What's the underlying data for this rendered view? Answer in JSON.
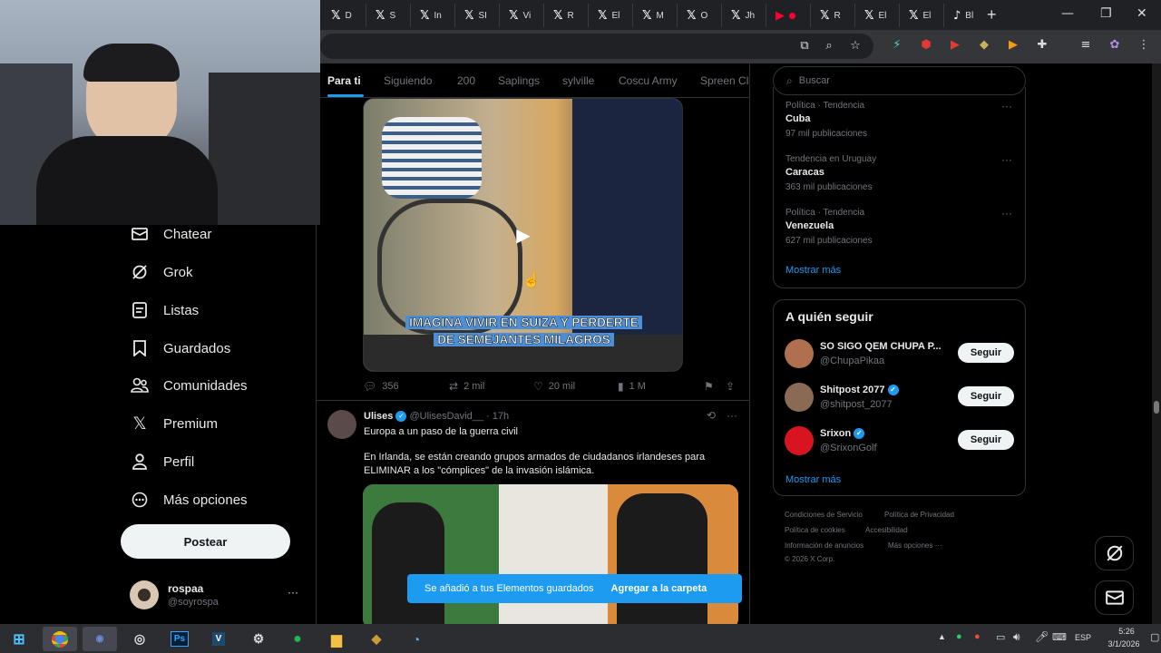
{
  "browser": {
    "tabs": [
      {
        "icon": "x-icon",
        "label": "D"
      },
      {
        "icon": "x-icon",
        "label": "S"
      },
      {
        "icon": "x-icon",
        "label": "In"
      },
      {
        "icon": "x-icon",
        "label": "SI"
      },
      {
        "icon": "x-icon",
        "label": "Vi"
      },
      {
        "icon": "x-icon",
        "label": "R"
      },
      {
        "icon": "x-icon",
        "label": "El"
      },
      {
        "icon": "x-icon",
        "label": "M"
      },
      {
        "icon": "x-icon",
        "label": "O"
      },
      {
        "icon": "x-icon",
        "label": "Jh"
      },
      {
        "icon": "youtube-icon",
        "label": ""
      },
      {
        "icon": "x-icon",
        "label": "R"
      },
      {
        "icon": "x-icon",
        "label": "El"
      },
      {
        "icon": "x-icon",
        "label": "El"
      },
      {
        "icon": "tiktok-icon",
        "label": "Bl"
      }
    ],
    "new_tab": "+"
  },
  "nav": {
    "items": [
      {
        "id": "chat",
        "label": "Chatear",
        "icon": "mail-icon"
      },
      {
        "id": "grok",
        "label": "Grok",
        "icon": "grok-icon"
      },
      {
        "id": "lists",
        "label": "Listas",
        "icon": "list-icon"
      },
      {
        "id": "bookmarks",
        "label": "Guardados",
        "icon": "bookmark-icon"
      },
      {
        "id": "communities",
        "label": "Comunidades",
        "icon": "people-icon"
      },
      {
        "id": "premium",
        "label": "Premium",
        "icon": "x-logo-icon"
      },
      {
        "id": "profile",
        "label": "Perfil",
        "icon": "user-icon"
      },
      {
        "id": "more",
        "label": "Más opciones",
        "icon": "more-circle-icon"
      }
    ],
    "post_label": "Postear",
    "account": {
      "name": "rospaa",
      "handle": "@soyrospa",
      "more": "···"
    }
  },
  "feed": {
    "tabs": [
      "Para ti",
      "Siguiendo",
      "200",
      "Saplings",
      "sylville",
      "Coscu Army",
      "Spreen Cl"
    ],
    "video_caption": [
      "IMAGINA VIVIR EN SUIZA Y PERDERTE",
      "DE SEMEJANTES MILAGROS"
    ],
    "tweet1_stats": {
      "replies": "356",
      "reposts": "2 mil",
      "likes": "20 mil",
      "views": "1 M"
    },
    "tweet2": {
      "name": "Ulises",
      "handle": "@UlisesDavid__",
      "time": "· 17h",
      "line1": "Europa a un paso de la guerra civil",
      "line2": "En Irlanda, se están creando grupos armados de ciudadanos irlandeses para ELIMINAR a los \"cómplices\" de la invasión islámica."
    },
    "toast": {
      "message": "Se añadió a tus Elementos guardados",
      "action": "Agregar a la carpeta"
    }
  },
  "sidebar": {
    "search_placeholder": "Buscar",
    "trends": [
      {
        "context": "Política · Tendencia",
        "name": "Cuba",
        "count": "97 mil publicaciones"
      },
      {
        "context": "Tendencia en Uruguay",
        "name": "Caracas",
        "count": "363 mil publicaciones"
      },
      {
        "context": "Política · Tendencia",
        "name": "Venezuela",
        "count": "627 mil publicaciones"
      }
    ],
    "show_more": "Mostrar más",
    "who_to_follow_title": "A quién seguir",
    "who_to_follow": [
      {
        "name": "SO SIGO QEM CHUPA P...",
        "handle": "@ChupaPikaa",
        "verified": false
      },
      {
        "name": "Shitpost 2077",
        "handle": "@shitpost_2077",
        "verified": true
      },
      {
        "name": "Srixon",
        "handle": "@SrixonGolf",
        "verified": true
      }
    ],
    "follow_label": "Seguir",
    "footer": [
      "Condiciones de Servicio",
      "Política de Privacidad",
      "Política de cookies",
      "Accesibilidad",
      "Información de anuncios",
      "Más opciones ···",
      "© 2026 X Corp."
    ]
  },
  "taskbar": {
    "lang": "ESP",
    "time": "5:26",
    "date": "3/1/2026"
  },
  "colors": {
    "accent": "#1d9bf0",
    "background": "#000000",
    "border": "#2f3336",
    "muted": "#71767b"
  }
}
